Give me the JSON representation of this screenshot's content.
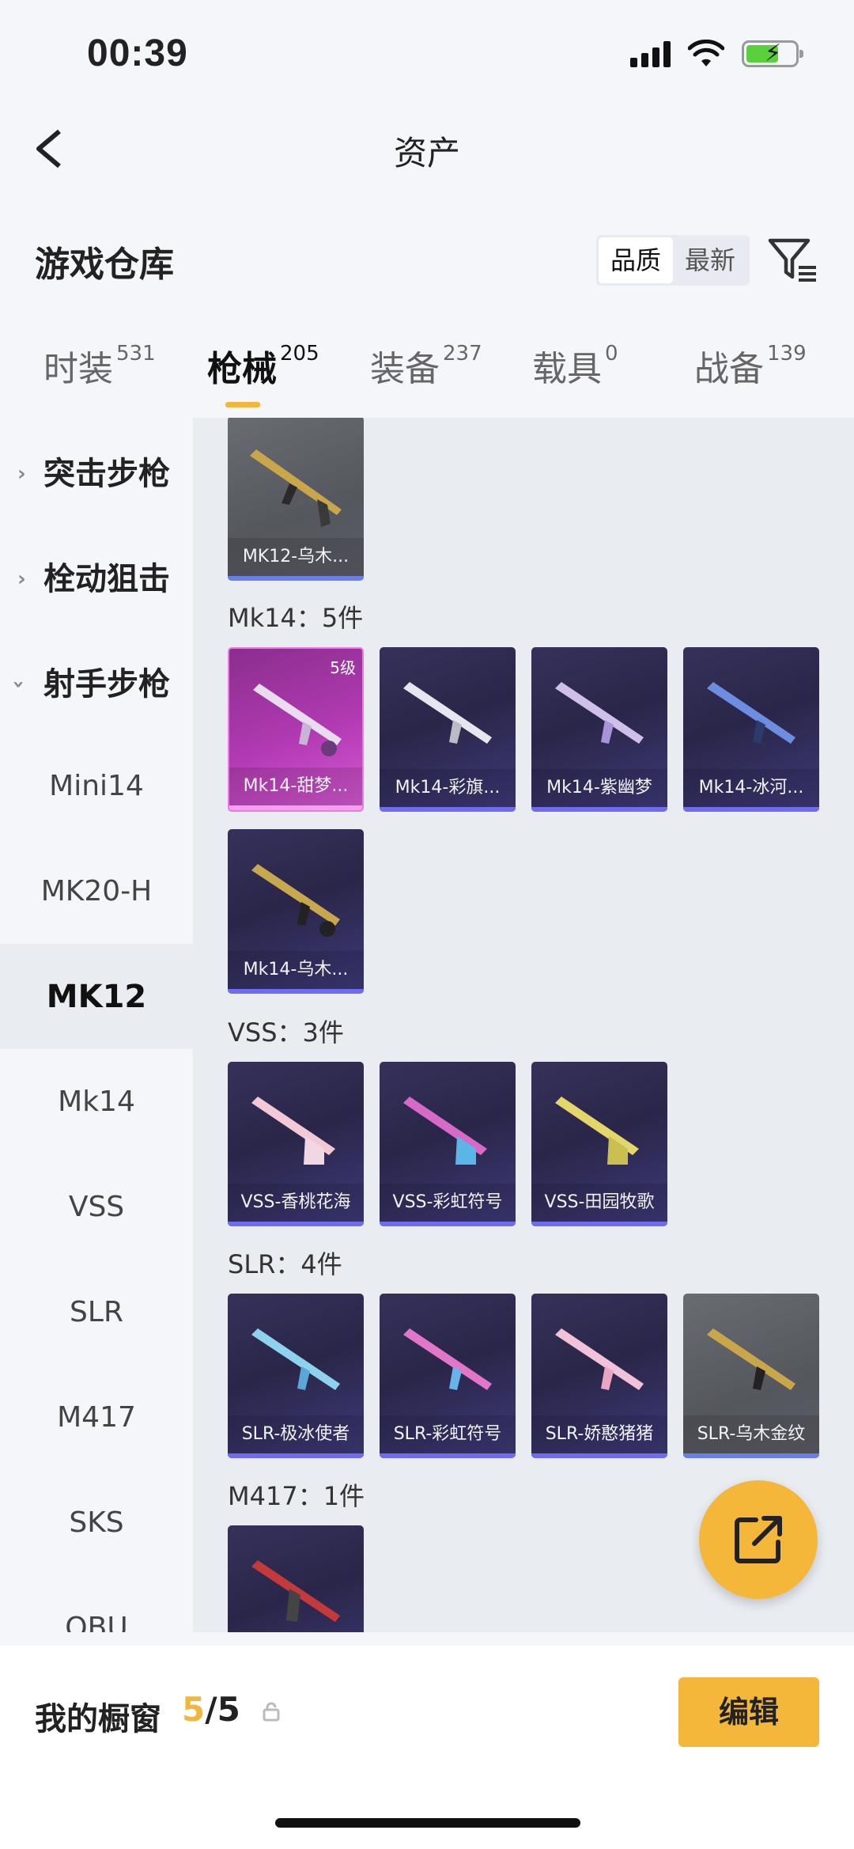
{
  "status_bar": {
    "time": "00:39"
  },
  "nav": {
    "title": "资产"
  },
  "warehouse": {
    "title": "游戏仓库",
    "sort": {
      "quality": "品质",
      "newest": "最新"
    }
  },
  "tabs": [
    {
      "label": "时装",
      "count": "531"
    },
    {
      "label": "枪械",
      "count": "205"
    },
    {
      "label": "装备",
      "count": "237"
    },
    {
      "label": "载具",
      "count": "0"
    },
    {
      "label": "战备",
      "count": "139"
    }
  ],
  "sidebar": {
    "categories": [
      {
        "label": "突击步枪"
      },
      {
        "label": "栓动狙击"
      },
      {
        "label": "射手步枪"
      }
    ],
    "subs": [
      "Mini14",
      "MK20-H",
      "MK12",
      "Mk14",
      "VSS",
      "SLR",
      "M417",
      "SKS",
      "QBU"
    ]
  },
  "content": {
    "mk12": [
      {
        "name": "MK12-乌木..."
      }
    ],
    "mk14_label": "Mk14：5件",
    "mk14": [
      {
        "name": "Mk14-甜梦...",
        "level": "5级"
      },
      {
        "name": "Mk14-彩旗..."
      },
      {
        "name": "Mk14-紫幽梦"
      },
      {
        "name": "Mk14-冰河..."
      },
      {
        "name": "Mk14-乌木..."
      }
    ],
    "vss_label": "VSS：3件",
    "vss": [
      {
        "name": "VSS-香桃花海"
      },
      {
        "name": "VSS-彩虹符号"
      },
      {
        "name": "VSS-田园牧歌"
      }
    ],
    "slr_label": "SLR：4件",
    "slr": [
      {
        "name": "SLR-极冰使者"
      },
      {
        "name": "SLR-彩虹符号"
      },
      {
        "name": "SLR-娇憨猪猪"
      },
      {
        "name": "SLR-乌木金纹"
      }
    ],
    "m417_label": "M417：1件"
  },
  "bottom": {
    "label": "我的橱窗",
    "count_current": "5",
    "count_total": "/5",
    "edit": "编辑"
  },
  "colors": {
    "accent": "#f4b73a",
    "card_bg": "#2a2649",
    "pink_card": "#b23ab3"
  }
}
